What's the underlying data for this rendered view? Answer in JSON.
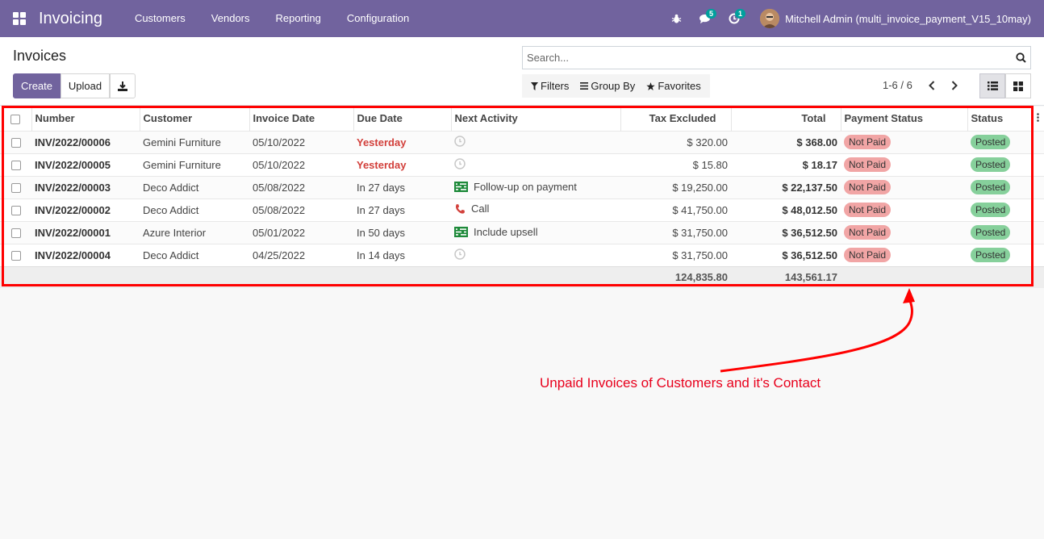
{
  "navbar": {
    "app_title": "Invoicing",
    "menu": [
      "Customers",
      "Vendors",
      "Reporting",
      "Configuration"
    ],
    "messages_badge": "5",
    "activities_badge": "1",
    "user_name": "Mitchell Admin (multi_invoice_payment_V15_10may)",
    "color": "#71639e"
  },
  "control": {
    "title": "Invoices",
    "create_label": "Create",
    "upload_label": "Upload",
    "search_placeholder": "Search...",
    "filters_label": "Filters",
    "groupby_label": "Group By",
    "favorites_label": "Favorites",
    "pager": "1-6 / 6"
  },
  "table": {
    "headers": {
      "number": "Number",
      "customer": "Customer",
      "invoice_date": "Invoice Date",
      "due_date": "Due Date",
      "next_activity": "Next Activity",
      "tax_excluded": "Tax Excluded",
      "total": "Total",
      "payment_status": "Payment Status",
      "status": "Status"
    },
    "rows": [
      {
        "number": "INV/2022/00006",
        "customer": "Gemini Furniture",
        "invoice_date": "05/10/2022",
        "due_date": "Yesterday",
        "overdue": true,
        "activity_icon": "clock-icon",
        "activity": "",
        "tax_excluded": "$ 320.00",
        "total": "$ 368.00",
        "payment_status": "Not Paid",
        "status": "Posted"
      },
      {
        "number": "INV/2022/00005",
        "customer": "Gemini Furniture",
        "invoice_date": "05/10/2022",
        "due_date": "Yesterday",
        "overdue": true,
        "activity_icon": "clock-icon",
        "activity": "",
        "tax_excluded": "$ 15.80",
        "total": "$ 18.17",
        "payment_status": "Not Paid",
        "status": "Posted"
      },
      {
        "number": "INV/2022/00003",
        "customer": "Deco Addict",
        "invoice_date": "05/08/2022",
        "due_date": "In 27 days",
        "overdue": false,
        "activity_icon": "tasks-icon",
        "activity": "Follow-up on payment",
        "tax_excluded": "$ 19,250.00",
        "total": "$ 22,137.50",
        "payment_status": "Not Paid",
        "status": "Posted"
      },
      {
        "number": "INV/2022/00002",
        "customer": "Deco Addict",
        "invoice_date": "05/08/2022",
        "due_date": "In 27 days",
        "overdue": false,
        "activity_icon": "phone-icon",
        "activity": "Call",
        "tax_excluded": "$ 41,750.00",
        "total": "$ 48,012.50",
        "payment_status": "Not Paid",
        "status": "Posted"
      },
      {
        "number": "INV/2022/00001",
        "customer": "Azure Interior",
        "invoice_date": "05/01/2022",
        "due_date": "In 50 days",
        "overdue": false,
        "activity_icon": "tasks-icon",
        "activity": "Include upsell",
        "tax_excluded": "$ 31,750.00",
        "total": "$ 36,512.50",
        "payment_status": "Not Paid",
        "status": "Posted"
      },
      {
        "number": "INV/2022/00004",
        "customer": "Deco Addict",
        "invoice_date": "04/25/2022",
        "due_date": "In 14 days",
        "overdue": false,
        "activity_icon": "clock-icon",
        "activity": "",
        "tax_excluded": "$ 31,750.00",
        "total": "$ 36,512.50",
        "payment_status": "Not Paid",
        "status": "Posted"
      }
    ],
    "totals": {
      "tax_excluded": "124,835.80",
      "total": "143,561.17"
    }
  },
  "annotation": {
    "text": "Unpaid Invoices of Customers and it's Contact",
    "color": "#ff0000"
  }
}
